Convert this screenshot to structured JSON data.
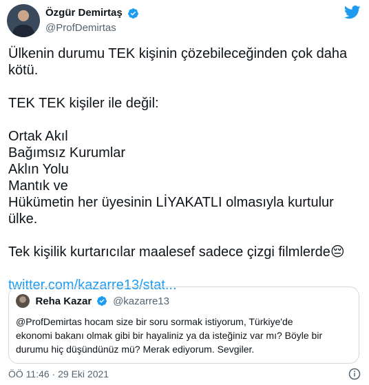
{
  "author": {
    "name": "Özgür Demirtaş",
    "handle": "@ProfDemirtas"
  },
  "tweet": {
    "line1": "Ülkenin durumu TEK kişinin çözebileceğinden çok daha",
    "line2": "kötü.",
    "line3": "TEK TEK kişiler ile değil:",
    "list": [
      "Ortak Akıl",
      "Bağımsız Kurumlar",
      "Aklın Yolu",
      "Mantık ve",
      "Hükümetin her üyesinin LİYAKATLI olmasıyla kurtulur ülke."
    ],
    "closing": "Tek kişilik kurtarıcılar maalesef sadece çizgi filmlerde😔",
    "link": "twitter.com/kazarre13/stat..."
  },
  "quoted": {
    "name": "Reha Kazar",
    "handle": "@kazarre13",
    "text_lines": [
      "@ProfDemirtas hocam size bir soru sormak istiyorum, Türkiye'de",
      "ekonomi bakanı olmak gibi bir hayaliniz ya da isteğiniz var mı? Böyle bir",
      "durumu hiç düşündünüz mü? Merak ediyorum. Sevgiler."
    ]
  },
  "timestamp": "ÖÖ 11:46 · 29 Eki 2021",
  "colors": {
    "verified": "#1d9bf0",
    "link": "#1d9bf0",
    "twitter_bird": "#1d9bf0"
  }
}
